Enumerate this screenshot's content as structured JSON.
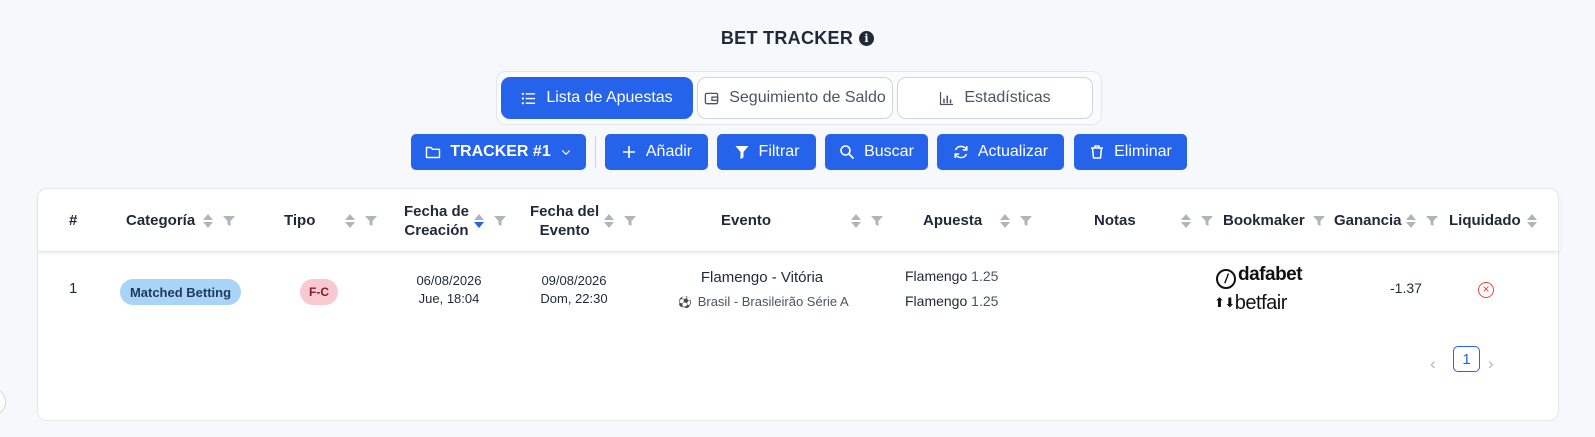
{
  "page": {
    "title": "BET TRACKER",
    "info_icon": "info-icon"
  },
  "tabs": [
    {
      "label": "Lista de Apuestas",
      "icon": "list-icon",
      "active": true
    },
    {
      "label": "Seguimiento de Saldo",
      "icon": "wallet-icon",
      "active": false
    },
    {
      "label": "Estadísticas",
      "icon": "bar-chart-icon",
      "active": false
    }
  ],
  "toolbar": {
    "tracker_select": "TRACKER #1",
    "add": "Añadir",
    "filter": "Filtrar",
    "search": "Buscar",
    "refresh": "Actualizar",
    "delete": "Eliminar"
  },
  "table": {
    "columns": {
      "index": "#",
      "category": "Categoría",
      "type": "Tipo",
      "created_1": "Fecha de",
      "created_2": "Creación",
      "event_date_1": "Fecha del",
      "event_date_2": "Evento",
      "event": "Evento",
      "bet": "Apuesta",
      "notes": "Notas",
      "bookmaker": "Bookmaker",
      "profit": "Ganancia",
      "settled": "Liquidado"
    },
    "rows": [
      {
        "index": "1",
        "category": "Matched Betting",
        "type": "F-C",
        "created_date": "06/08/2026",
        "created_time": "Jue, 18:04",
        "event_date": "09/08/2026",
        "event_time": "Dom, 22:30",
        "event_name": "Flamengo - Vitória",
        "competition": "Brasil - Brasileirão Série A",
        "bet_1": "Flamengo",
        "odds_1": "1.25",
        "bet_2": "Flamengo",
        "odds_2": "1.25",
        "notes": "",
        "bookmaker_1": "dafabet",
        "bookmaker_2": "betfair",
        "profit": "-1.37",
        "settled_icon": "x-circle-icon"
      }
    ]
  },
  "pagination": {
    "current": "1",
    "prev": "‹",
    "next": "›"
  },
  "colors": {
    "primary": "#2563eb",
    "matched_badge": "#a9d4f5",
    "type_badge": "#f8c9d1",
    "error": "#ef4444"
  }
}
